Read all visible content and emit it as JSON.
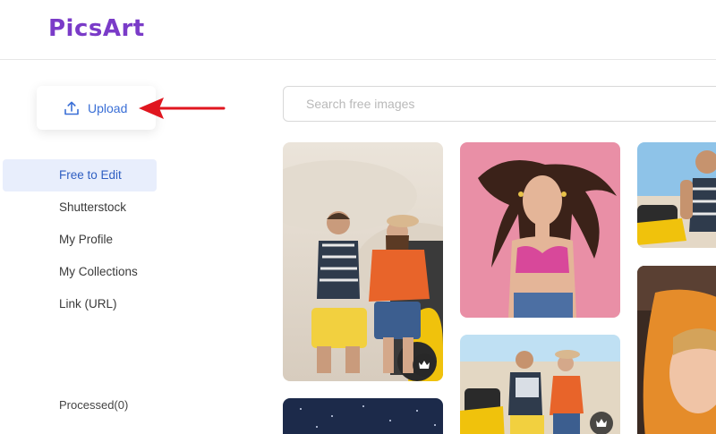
{
  "header": {
    "logo": "PicsArt"
  },
  "upload": {
    "label": "Upload",
    "icon": "upload-icon",
    "accent": "#3a6fd6"
  },
  "sidebar": {
    "items": [
      {
        "label": "Free to Edit",
        "active": true
      },
      {
        "label": "Shutterstock",
        "active": false
      },
      {
        "label": "My Profile",
        "active": false
      },
      {
        "label": "My Collections",
        "active": false
      },
      {
        "label": "Link (URL)",
        "active": false
      }
    ],
    "processed": "Processed(0)"
  },
  "search": {
    "placeholder": "Search free images",
    "value": ""
  },
  "gallery": {
    "images": [
      {
        "subject": "couple-quad-bike-beach",
        "premium": true
      },
      {
        "subject": "woman-pink-background",
        "premium": false
      },
      {
        "subject": "man-quad-bike",
        "premium": false
      },
      {
        "subject": "couple-quad-bike-desert",
        "premium": true
      },
      {
        "subject": "woman-portrait-orange",
        "premium": false
      },
      {
        "subject": "night-sky",
        "premium": false
      }
    ],
    "premium_icon": "crown-icon"
  },
  "annotation": {
    "arrow_color": "#e0161f"
  },
  "colors": {
    "brand": "#7a3bc8",
    "active_bg": "#e8eefc",
    "active_text": "#2f5fc2"
  }
}
